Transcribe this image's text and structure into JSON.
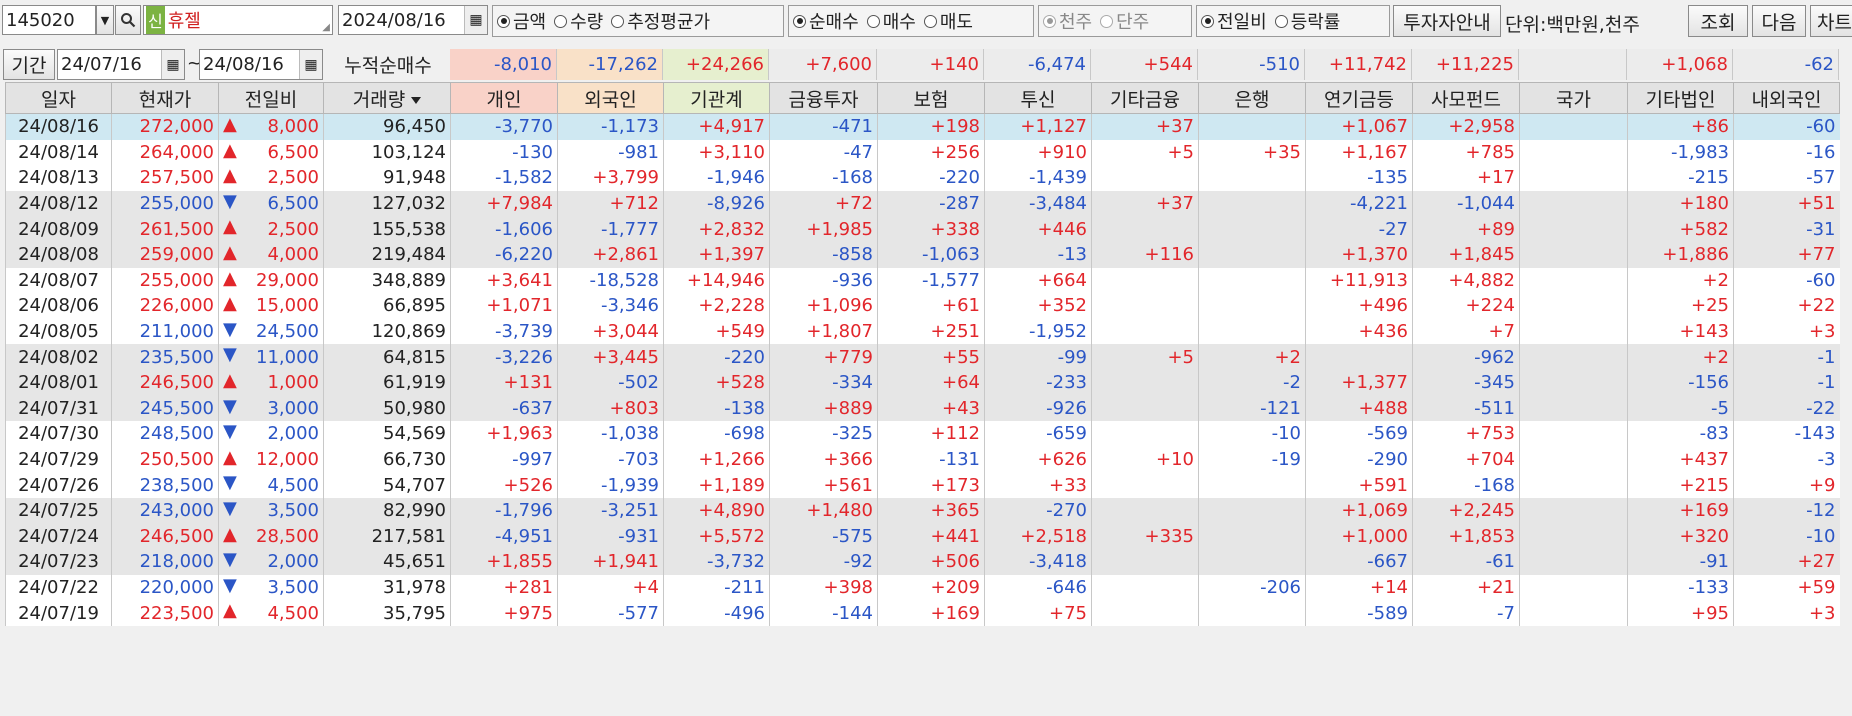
{
  "toolbar": {
    "code": "145020",
    "new_badge": "신",
    "stock_name": "휴젤",
    "date": "2024/08/16",
    "unit_group": [
      {
        "label": "금액",
        "on": true
      },
      {
        "label": "수량",
        "on": false
      },
      {
        "label": "추정평균가",
        "on": false
      }
    ],
    "type_group": [
      {
        "label": "순매수",
        "on": true
      },
      {
        "label": "매수",
        "on": false
      },
      {
        "label": "매도",
        "on": false
      }
    ],
    "scale_group": [
      {
        "label": "천주",
        "on": true
      },
      {
        "label": "단주",
        "on": false
      }
    ],
    "change_group": [
      {
        "label": "전일비",
        "on": true
      },
      {
        "label": "등락률",
        "on": false
      }
    ],
    "investor_guide": "투자자안내",
    "unit_text": "단위:백만원,천주",
    "lookup": "조회",
    "next": "다음",
    "chart": "차트"
  },
  "period": {
    "label": "기간",
    "from": "24/07/16",
    "tilde": "~",
    "to": "24/08/16",
    "cumulative_label": "누적순매수",
    "totals": [
      "-8,010",
      "-17,262",
      "+24,266",
      "+7,600",
      "+140",
      "-6,474",
      "+544",
      "-510",
      "+11,742",
      "+11,225",
      "",
      "+1,068",
      "-62"
    ]
  },
  "columns": [
    "일자",
    "현재가",
    "전일비",
    "거래량",
    "개인",
    "외국인",
    "기관계",
    "금융투자",
    "보험",
    "투신",
    "기타금융",
    "은행",
    "연기금등",
    "사모펀드",
    "국가",
    "기타법인",
    "내외국인"
  ],
  "colors": {
    "up": "#e2262b",
    "down": "#2b56c6",
    "selected": "#cfe8f2",
    "header_individual": "#f9d2c8",
    "header_foreign": "#f9e1c8",
    "header_inst": "#e6efcf"
  },
  "rows": [
    {
      "d": "24/08/16",
      "p": "272,000",
      "dir": "up",
      "c": "8,000",
      "v": "96,450",
      "vals": [
        "-3,770",
        "-1,173",
        "+4,917",
        "-471",
        "+198",
        "+1,127",
        "+37",
        "",
        "+1,067",
        "+2,958",
        "",
        "+86",
        "-60"
      ]
    },
    {
      "d": "24/08/14",
      "p": "264,000",
      "dir": "up",
      "c": "6,500",
      "v": "103,124",
      "vals": [
        "-130",
        "-981",
        "+3,110",
        "-47",
        "+256",
        "+910",
        "+5",
        "+35",
        "+1,167",
        "+785",
        "",
        "-1,983",
        "-16"
      ]
    },
    {
      "d": "24/08/13",
      "p": "257,500",
      "dir": "up",
      "c": "2,500",
      "v": "91,948",
      "vals": [
        "-1,582",
        "+3,799",
        "-1,946",
        "-168",
        "-220",
        "-1,439",
        "",
        "",
        "-135",
        "+17",
        "",
        "-215",
        "-57"
      ]
    },
    {
      "d": "24/08/12",
      "p": "255,000",
      "dir": "down",
      "c": "6,500",
      "v": "127,032",
      "vals": [
        "+7,984",
        "+712",
        "-8,926",
        "+72",
        "-287",
        "-3,484",
        "+37",
        "",
        "-4,221",
        "-1,044",
        "",
        "+180",
        "+51"
      ]
    },
    {
      "d": "24/08/09",
      "p": "261,500",
      "dir": "up",
      "c": "2,500",
      "v": "155,538",
      "vals": [
        "-1,606",
        "-1,777",
        "+2,832",
        "+1,985",
        "+338",
        "+446",
        "",
        "",
        "-27",
        "+89",
        "",
        "+582",
        "-31"
      ]
    },
    {
      "d": "24/08/08",
      "p": "259,000",
      "dir": "up",
      "c": "4,000",
      "v": "219,484",
      "vals": [
        "-6,220",
        "+2,861",
        "+1,397",
        "-858",
        "-1,063",
        "-13",
        "+116",
        "",
        "+1,370",
        "+1,845",
        "",
        "+1,886",
        "+77"
      ]
    },
    {
      "d": "24/08/07",
      "p": "255,000",
      "dir": "up",
      "c": "29,000",
      "v": "348,889",
      "vals": [
        "+3,641",
        "-18,528",
        "+14,946",
        "-936",
        "-1,577",
        "+664",
        "",
        "",
        "+11,913",
        "+4,882",
        "",
        "+2",
        "-60"
      ]
    },
    {
      "d": "24/08/06",
      "p": "226,000",
      "dir": "up",
      "c": "15,000",
      "v": "66,895",
      "vals": [
        "+1,071",
        "-3,346",
        "+2,228",
        "+1,096",
        "+61",
        "+352",
        "",
        "",
        "+496",
        "+224",
        "",
        "+25",
        "+22"
      ]
    },
    {
      "d": "24/08/05",
      "p": "211,000",
      "dir": "down",
      "c": "24,500",
      "v": "120,869",
      "vals": [
        "-3,739",
        "+3,044",
        "+549",
        "+1,807",
        "+251",
        "-1,952",
        "",
        "",
        "+436",
        "+7",
        "",
        "+143",
        "+3"
      ]
    },
    {
      "d": "24/08/02",
      "p": "235,500",
      "dir": "down",
      "c": "11,000",
      "v": "64,815",
      "vals": [
        "-3,226",
        "+3,445",
        "-220",
        "+779",
        "+55",
        "-99",
        "+5",
        "+2",
        "",
        "-962",
        "",
        "+2",
        "-1"
      ]
    },
    {
      "d": "24/08/01",
      "p": "246,500",
      "dir": "up",
      "c": "1,000",
      "v": "61,919",
      "vals": [
        "+131",
        "-502",
        "+528",
        "-334",
        "+64",
        "-233",
        "",
        "-2",
        "+1,377",
        "-345",
        "",
        "-156",
        "-1"
      ]
    },
    {
      "d": "24/07/31",
      "p": "245,500",
      "dir": "down",
      "c": "3,000",
      "v": "50,980",
      "vals": [
        "-637",
        "+803",
        "-138",
        "+889",
        "+43",
        "-926",
        "",
        "-121",
        "+488",
        "-511",
        "",
        "-5",
        "-22"
      ]
    },
    {
      "d": "24/07/30",
      "p": "248,500",
      "dir": "down",
      "c": "2,000",
      "v": "54,569",
      "vals": [
        "+1,963",
        "-1,038",
        "-698",
        "-325",
        "+112",
        "-659",
        "",
        "-10",
        "-569",
        "+753",
        "",
        "-83",
        "-143"
      ]
    },
    {
      "d": "24/07/29",
      "p": "250,500",
      "dir": "up",
      "c": "12,000",
      "v": "66,730",
      "vals": [
        "-997",
        "-703",
        "+1,266",
        "+366",
        "-131",
        "+626",
        "+10",
        "-19",
        "-290",
        "+704",
        "",
        "+437",
        "-3"
      ]
    },
    {
      "d": "24/07/26",
      "p": "238,500",
      "dir": "down",
      "c": "4,500",
      "v": "54,707",
      "vals": [
        "+526",
        "-1,939",
        "+1,189",
        "+561",
        "+173",
        "+33",
        "",
        "",
        "+591",
        "-168",
        "",
        "+215",
        "+9"
      ]
    },
    {
      "d": "24/07/25",
      "p": "243,000",
      "dir": "down",
      "c": "3,500",
      "v": "82,990",
      "vals": [
        "-1,796",
        "-3,251",
        "+4,890",
        "+1,480",
        "+365",
        "-270",
        "",
        "",
        "+1,069",
        "+2,245",
        "",
        "+169",
        "-12"
      ]
    },
    {
      "d": "24/07/24",
      "p": "246,500",
      "dir": "up",
      "c": "28,500",
      "v": "217,581",
      "vals": [
        "-4,951",
        "-931",
        "+5,572",
        "-575",
        "+441",
        "+2,518",
        "+335",
        "",
        "+1,000",
        "+1,853",
        "",
        "+320",
        "-10"
      ]
    },
    {
      "d": "24/07/23",
      "p": "218,000",
      "dir": "down",
      "c": "2,000",
      "v": "45,651",
      "vals": [
        "+1,855",
        "+1,941",
        "-3,732",
        "-92",
        "+506",
        "-3,418",
        "",
        "",
        "-667",
        "-61",
        "",
        "-91",
        "+27"
      ]
    },
    {
      "d": "24/07/22",
      "p": "220,000",
      "dir": "down",
      "c": "3,500",
      "v": "31,978",
      "vals": [
        "+281",
        "+4",
        "-211",
        "+398",
        "+209",
        "-646",
        "",
        "-206",
        "+14",
        "+21",
        "",
        "-133",
        "+59"
      ]
    },
    {
      "d": "24/07/19",
      "p": "223,500",
      "dir": "up",
      "c": "4,500",
      "v": "35,795",
      "vals": [
        "+975",
        "-577",
        "-496",
        "-144",
        "+169",
        "+75",
        "",
        "",
        "-589",
        "-7",
        "",
        "+95",
        "+3"
      ]
    }
  ]
}
